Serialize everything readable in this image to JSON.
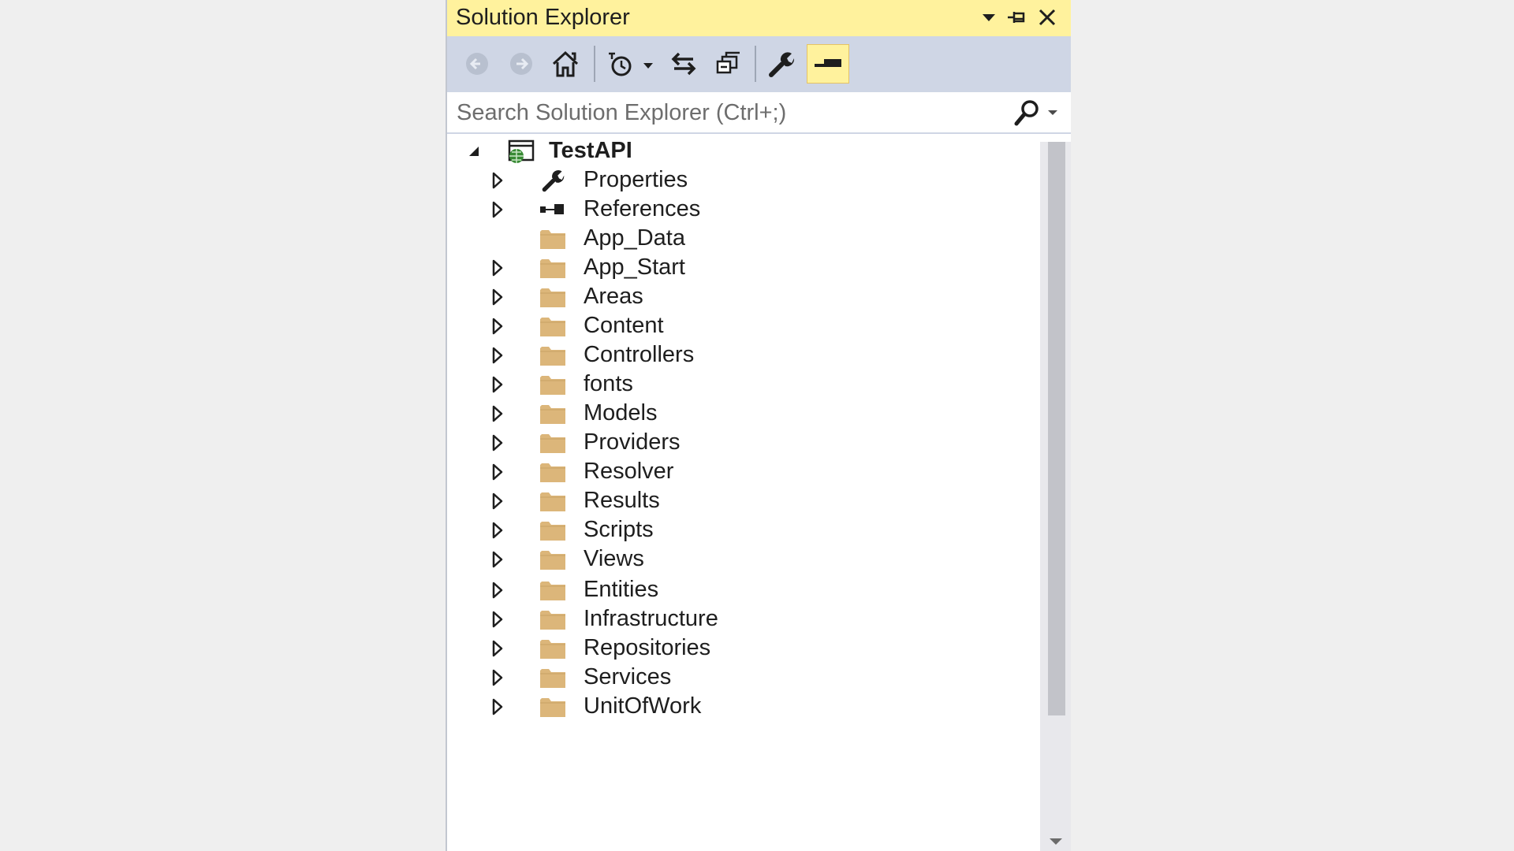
{
  "panel": {
    "title": "Solution Explorer",
    "controls": {
      "dropdown_icon": "chevron-down-icon",
      "pin_icon": "pin-icon",
      "close_icon": "close-icon"
    }
  },
  "toolbar": {
    "buttons": [
      {
        "name": "back-button",
        "icon": "arrow-left-circle-icon"
      },
      {
        "name": "forward-button",
        "icon": "arrow-right-circle-icon"
      },
      {
        "name": "home-button",
        "icon": "home-icon"
      },
      {
        "name": "pending-changes-filter-button",
        "icon": "clock-icon"
      },
      {
        "name": "sync-with-active-document-button",
        "icon": "sync-arrows-icon"
      },
      {
        "name": "collapse-all-button",
        "icon": "collapse-all-icon"
      },
      {
        "name": "properties-button",
        "icon": "wrench-icon"
      },
      {
        "name": "preview-selected-items-button",
        "icon": "preview-icon",
        "active": true
      }
    ]
  },
  "search": {
    "placeholder": "Search Solution Explorer (Ctrl+;)",
    "value": ""
  },
  "tree": {
    "root": {
      "label": "TestAPI",
      "expanded": true,
      "icon": "web-project-icon"
    },
    "items": [
      {
        "label": "Properties",
        "icon": "wrench-icon",
        "expandable": true
      },
      {
        "label": "References",
        "icon": "references-icon",
        "expandable": true
      },
      {
        "label": "App_Data",
        "icon": "folder-icon",
        "expandable": false
      },
      {
        "label": "App_Start",
        "icon": "folder-icon",
        "expandable": true
      },
      {
        "label": "Areas",
        "icon": "folder-icon",
        "expandable": true
      },
      {
        "label": "Content",
        "icon": "folder-icon",
        "expandable": true
      },
      {
        "label": "Controllers",
        "icon": "folder-icon",
        "expandable": true
      },
      {
        "label": "fonts",
        "icon": "folder-icon",
        "expandable": true
      },
      {
        "label": "Models",
        "icon": "folder-icon",
        "expandable": true
      },
      {
        "label": "Providers",
        "icon": "folder-icon",
        "expandable": true
      },
      {
        "label": "Resolver",
        "icon": "folder-icon",
        "expandable": true
      },
      {
        "label": "Results",
        "icon": "folder-icon",
        "expandable": true
      },
      {
        "label": "Scripts",
        "icon": "folder-icon",
        "expandable": true
      },
      {
        "label": "Views",
        "icon": "folder-icon",
        "expandable": true
      },
      {
        "label": "Entities",
        "icon": "folder-icon",
        "expandable": true
      },
      {
        "label": "Infrastructure",
        "icon": "folder-icon",
        "expandable": true
      },
      {
        "label": "Repositories",
        "icon": "folder-icon",
        "expandable": true
      },
      {
        "label": "Services",
        "icon": "folder-icon",
        "expandable": true
      },
      {
        "label": "UnitOfWork",
        "icon": "folder-icon",
        "expandable": true
      }
    ]
  },
  "colors": {
    "title_bar": "#fff29d",
    "toolbar": "#cfd6e5",
    "folder": "#dcb67a",
    "text": "#1e1e1e"
  }
}
